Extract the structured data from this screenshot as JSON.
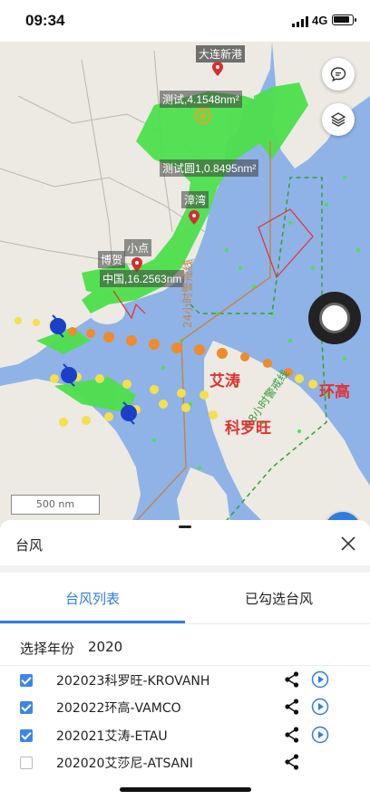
{
  "status_bar": {
    "time": "09:34",
    "network": "4G"
  },
  "map": {
    "labels": {
      "dalian_port": "大连新港",
      "test_area": "测试,4.1548nm²",
      "test_circle": "测试圆1,0.8495nm²",
      "test_overlap": "福建,12.9654nm",
      "zhangwan": "漳湾",
      "small_point": "小点",
      "bohe": "博贺",
      "china_dist": "中国,16.2563nm",
      "line_24": "24小时警戒线",
      "line_48": "48小时警戒线"
    },
    "typhoon_names": {
      "etau": "艾涛",
      "vamco": "环高",
      "krovanh": "科罗旺"
    },
    "scale": "500 nm",
    "level": "4级",
    "colors": {
      "land": "#eceae3",
      "sea": "#8fb3e6",
      "green": "#4de04d",
      "track_orange": "#f08a2a",
      "track_yellow": "#f4e04a",
      "alert_red": "#e03131",
      "accent": "#2f7de1"
    }
  },
  "sheet": {
    "title": "台风",
    "tabs": [
      "台风列表",
      "已勾选台风"
    ],
    "year_label": "选择年份",
    "year_value": "2020",
    "typhoons": [
      {
        "name": "202023科罗旺-KROVANH",
        "checked": true
      },
      {
        "name": "202022环高-VAMCO",
        "checked": true
      },
      {
        "name": "202021艾涛-ETAU",
        "checked": true
      },
      {
        "name": "202020艾莎尼-ATSANI",
        "checked": false
      }
    ]
  }
}
